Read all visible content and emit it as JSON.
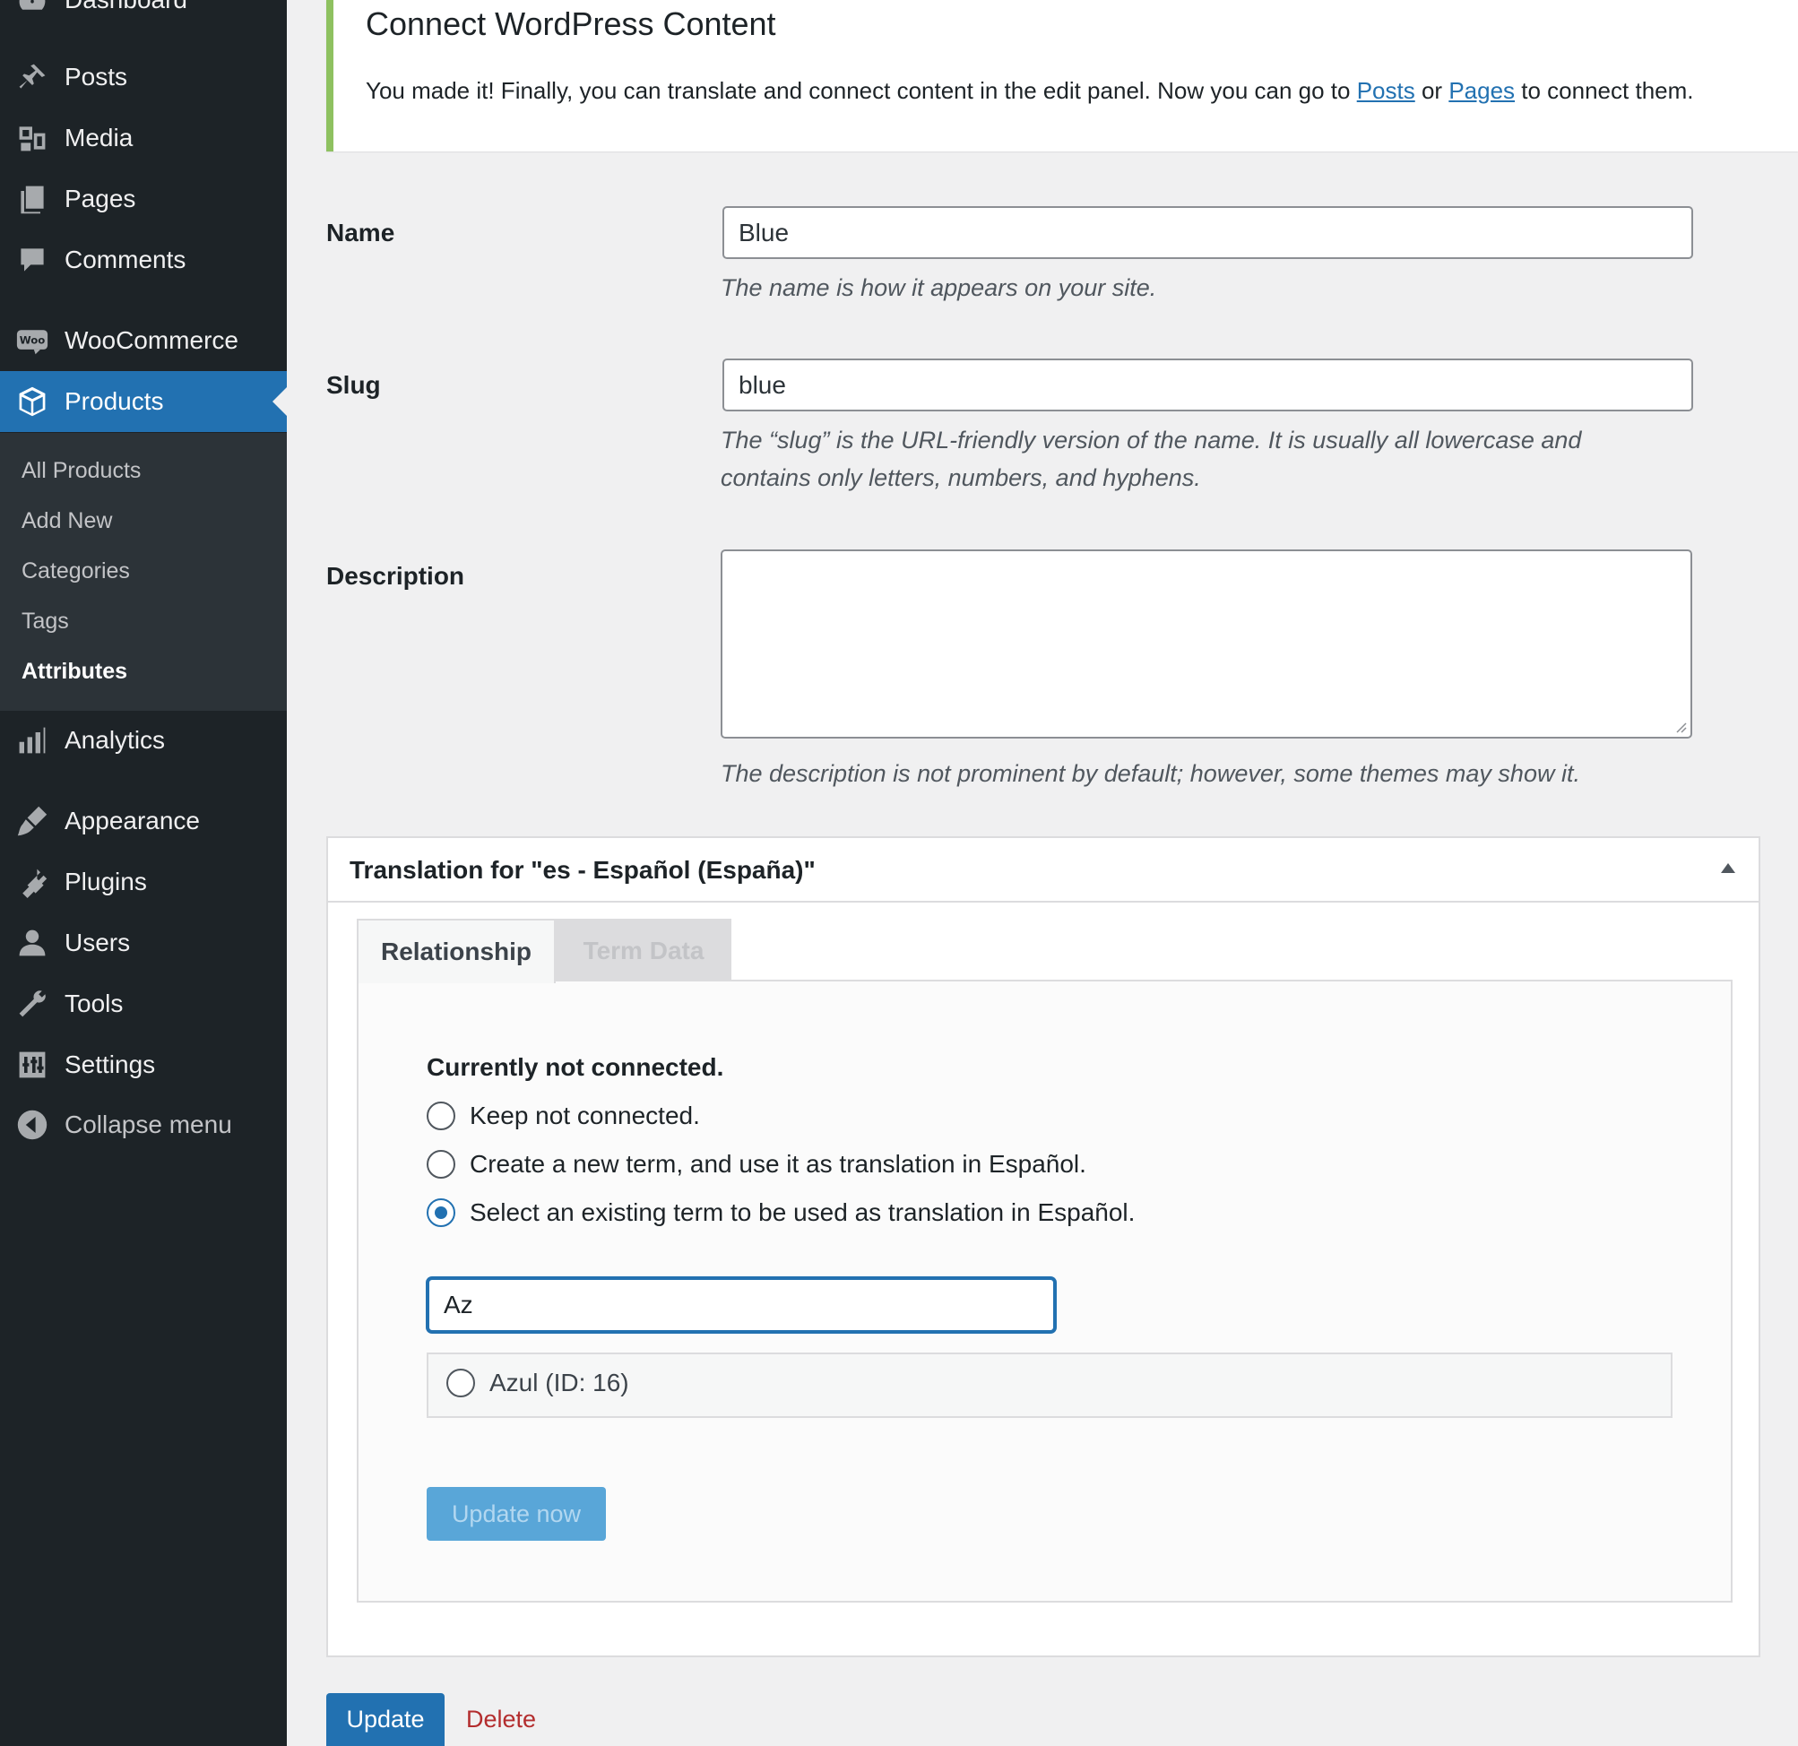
{
  "sidebar": {
    "items": [
      {
        "label": "Dashboard",
        "icon": "dashboard-icon"
      },
      {
        "label": "Posts",
        "icon": "pin-icon"
      },
      {
        "label": "Media",
        "icon": "media-icon"
      },
      {
        "label": "Pages",
        "icon": "pages-icon"
      },
      {
        "label": "Comments",
        "icon": "comment-icon"
      },
      {
        "label": "WooCommerce",
        "icon": "woo-icon"
      },
      {
        "label": "Products",
        "icon": "box-icon"
      },
      {
        "label": "Analytics",
        "icon": "bar-chart-icon"
      },
      {
        "label": "Appearance",
        "icon": "brush-icon"
      },
      {
        "label": "Plugins",
        "icon": "plug-icon"
      },
      {
        "label": "Users",
        "icon": "user-icon"
      },
      {
        "label": "Tools",
        "icon": "wrench-icon"
      },
      {
        "label": "Settings",
        "icon": "sliders-icon"
      },
      {
        "label": "Collapse menu",
        "icon": "collapse-icon"
      }
    ],
    "submenu": [
      "All Products",
      "Add New",
      "Categories",
      "Tags",
      "Attributes"
    ],
    "woo_badge": "Woo"
  },
  "notice": {
    "title": "Connect WordPress Content",
    "text_before": "You made it! Finally, you can translate and connect content in the edit panel. Now you can go to ",
    "link_posts": "Posts",
    "text_or": " or ",
    "link_pages": "Pages",
    "text_after": " to connect them."
  },
  "form": {
    "name_label": "Name",
    "name_value": "Blue",
    "name_help": "The name is how it appears on your site.",
    "slug_label": "Slug",
    "slug_value": "blue",
    "slug_help_line1": "The “slug” is the URL-friendly version of the name. It is usually all lowercase and",
    "slug_help_line2": "contains only letters, numbers, and hyphens.",
    "description_label": "Description",
    "description_value": "",
    "description_help": "The description is not prominent by default; however, some themes may show it."
  },
  "translation": {
    "title": "Translation for \"es - Español (España)\"",
    "tabs": [
      "Relationship",
      "Term Data"
    ],
    "status_heading": "Currently not connected.",
    "options": [
      "Keep not connected.",
      "Create a new term, and use it as translation in Español.",
      "Select an existing term to be used as translation in Español."
    ],
    "selected_option": 2,
    "search_value": "Az",
    "result_label": "Azul (ID: 16)",
    "update_now_label": "Update now"
  },
  "footer": {
    "update_label": "Update",
    "delete_label": "Delete"
  },
  "colors": {
    "sidebar_bg": "#1d2327",
    "active_menu": "#2271b1",
    "notice_border": "#8ec160",
    "link": "#2271b1",
    "delete": "#b32d2e"
  }
}
